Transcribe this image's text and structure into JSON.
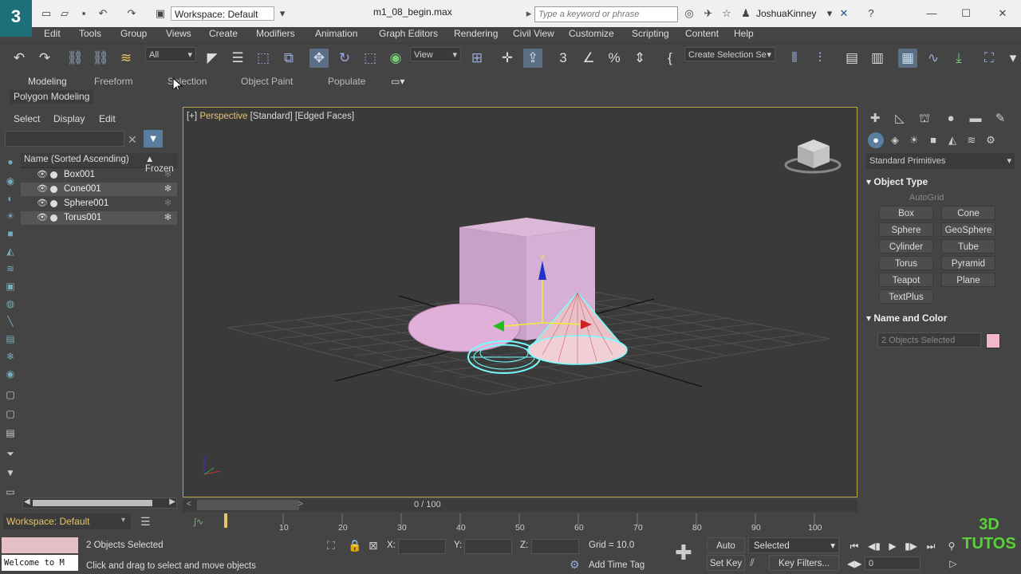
{
  "app": {
    "workspace": "Workspace: Default",
    "file_title": "m1_08_begin.max",
    "search_placeholder": "Type a keyword or phrase",
    "user": "JoshuaKinney"
  },
  "menu": [
    "Edit",
    "Tools",
    "Group",
    "Views",
    "Create",
    "Modifiers",
    "Animation",
    "Graph Editors",
    "Rendering",
    "Civil View",
    "Customize",
    "Scripting",
    "Content",
    "Help"
  ],
  "toolbar": {
    "filter": "All",
    "ref_coord": "View",
    "named_selection": "Create Selection Se"
  },
  "ribbon": {
    "tabs": [
      "Modeling",
      "Freeform",
      "Selection",
      "Object Paint",
      "Populate"
    ],
    "sub_label": "Polygon Modeling"
  },
  "explorer": {
    "menus": [
      "Select",
      "Display",
      "Edit"
    ],
    "col_name": "Name (Sorted Ascending)",
    "col_frozen": "▲ Frozen",
    "rows": [
      {
        "name": "Box001",
        "selected": false
      },
      {
        "name": "Cone001",
        "selected": true
      },
      {
        "name": "Sphere001",
        "selected": false
      },
      {
        "name": "Torus001",
        "selected": true
      }
    ],
    "workspace": "Workspace: Default"
  },
  "viewport": {
    "label_plus": "[+]",
    "label_persp": "Perspective",
    "label_std": "[Standard]",
    "label_faces": "[Edged Faces]"
  },
  "timeline": {
    "readout": "0 / 100",
    "ticks": [
      "10",
      "20",
      "30",
      "40",
      "50",
      "60",
      "70",
      "80",
      "90",
      "100"
    ]
  },
  "command_panel": {
    "category": "Standard Primitives",
    "object_type": "Object Type",
    "autogrid": "AutoGrid",
    "primitives": [
      "Box",
      "Cone",
      "Sphere",
      "GeoSphere",
      "Cylinder",
      "Tube",
      "Torus",
      "Pyramid",
      "Teapot",
      "Plane",
      "TextPlus"
    ],
    "name_and_color": "Name and Color",
    "name_value": "2 Objects Selected",
    "color": "#f0b8c8"
  },
  "status": {
    "listener": "Welcome to M",
    "selection": "2 Objects Selected",
    "prompt": "Click and drag to select and move objects",
    "x_label": "X:",
    "y_label": "Y:",
    "z_label": "Z:",
    "grid": "Grid = 10.0",
    "time_tag": "Add Time Tag",
    "auto_key": "Auto Key",
    "set_key": "Set Key",
    "selected": "Selected",
    "key_filters": "Key Filters...",
    "frame": "0"
  },
  "watermark": [
    "3D",
    "TUTOS"
  ]
}
